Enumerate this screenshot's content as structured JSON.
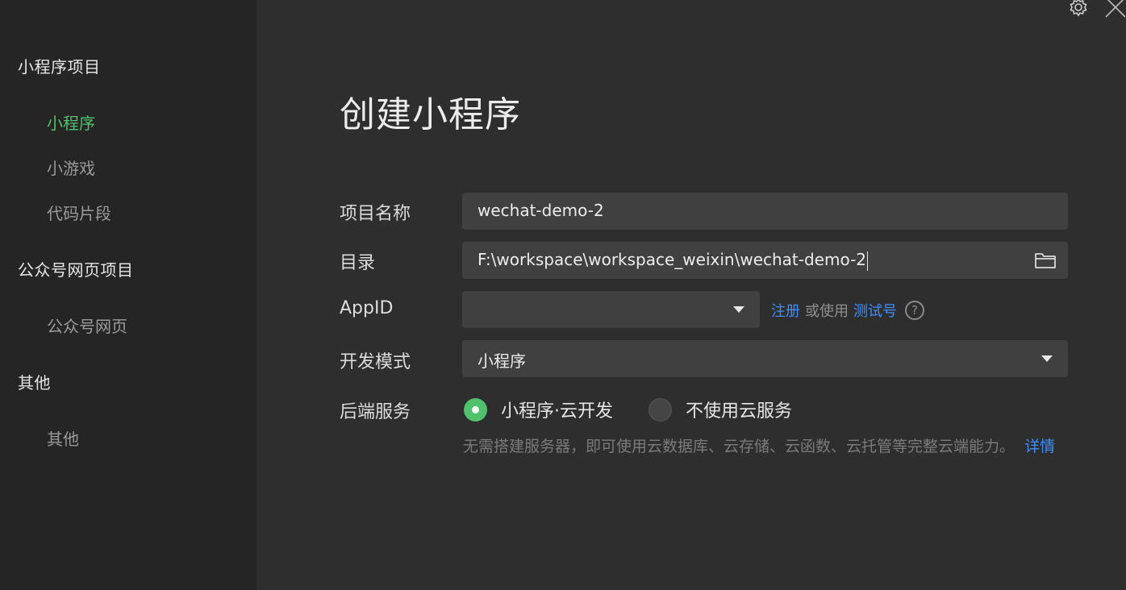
{
  "sidebar": {
    "categories": [
      {
        "label": "小程序项目",
        "items": [
          "小程序",
          "小游戏",
          "代码片段"
        ]
      },
      {
        "label": "公众号网页项目",
        "items": [
          "公众号网页"
        ]
      },
      {
        "label": "其他",
        "items": [
          "其他"
        ]
      }
    ],
    "active_item": "小程序"
  },
  "window_controls": {
    "settings_icon": "gear-icon",
    "close_icon": "close-icon"
  },
  "main": {
    "title": "创建小程序",
    "fields": {
      "project_name": {
        "label": "项目名称",
        "value": "wechat-demo-2"
      },
      "directory": {
        "label": "目录",
        "value": "F:\\workspace\\workspace_weixin\\wechat-demo-2"
      },
      "appid": {
        "label": "AppID",
        "value": "",
        "register_link": "注册",
        "or_use_text": "或使用",
        "test_account_link": "测试号",
        "help_symbol": "?"
      },
      "dev_mode": {
        "label": "开发模式",
        "value": "小程序"
      },
      "backend": {
        "label": "后端服务",
        "options": [
          {
            "label": "小程序·云开发",
            "checked": true
          },
          {
            "label": "不使用云服务",
            "checked": false
          }
        ],
        "description": "无需搭建服务器，即可使用云数据库、云存储、云函数、云托管等完整云端能力。",
        "details_link": "详情"
      }
    }
  },
  "colors": {
    "accent_green": "#4fc26b",
    "link_blue": "#3e8ef7",
    "background": "#2e2e2e",
    "sidebar_background": "#252525",
    "input_background": "#404040"
  }
}
